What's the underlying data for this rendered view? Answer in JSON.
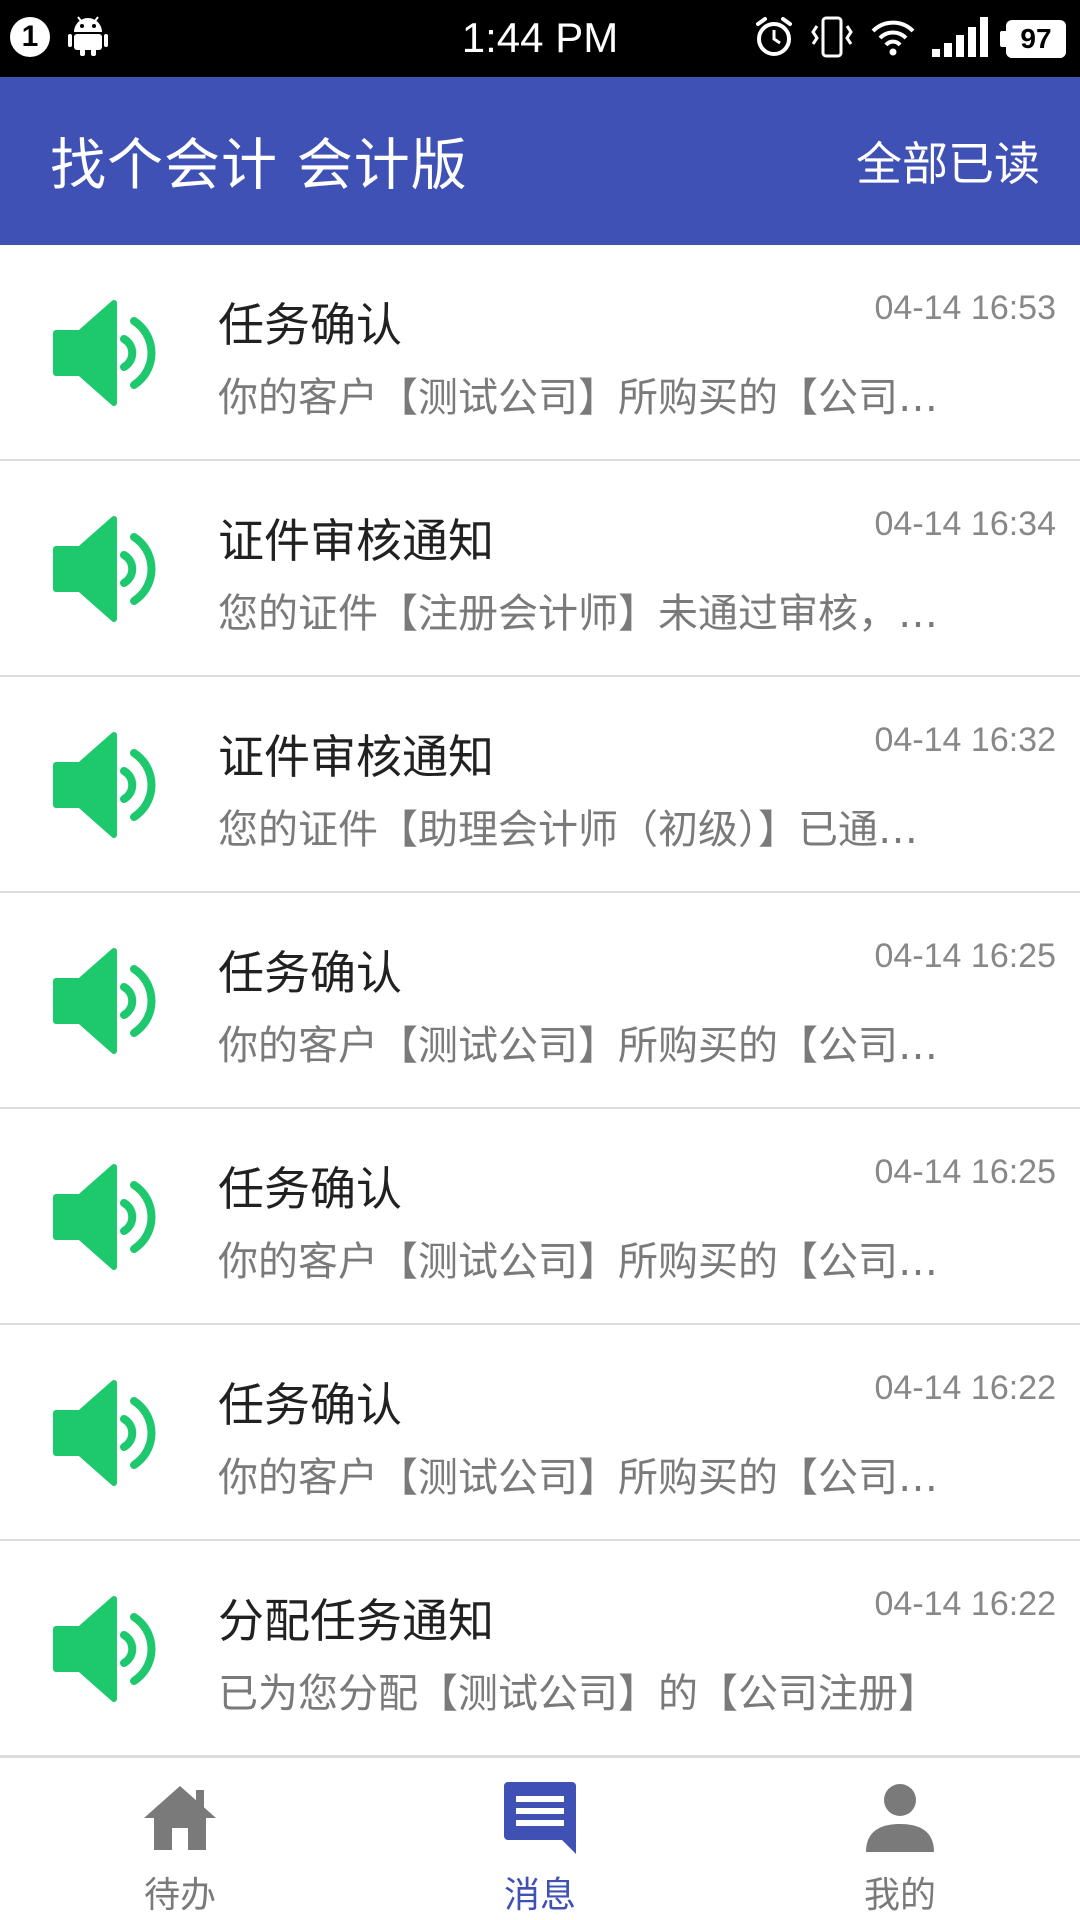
{
  "status_bar": {
    "notification_count": "1",
    "time": "1:44 PM",
    "battery": "97",
    "icons": [
      "android-icon",
      "alarm-icon",
      "vibrate-icon",
      "wifi-icon",
      "signal-icon",
      "battery-icon"
    ]
  },
  "app_bar": {
    "title": "找个会计 会计版",
    "mark_all_read": "全部已读"
  },
  "messages": [
    {
      "title": "任务确认",
      "time": "04-14 16:53",
      "summary": "你的客户【测试公司】所购买的【公司…",
      "icon": "speaker-icon"
    },
    {
      "title": "证件审核通知",
      "time": "04-14 16:34",
      "summary": "您的证件【注册会计师】未通过审核，…",
      "icon": "speaker-icon"
    },
    {
      "title": "证件审核通知",
      "time": "04-14 16:32",
      "summary": "您的证件【助理会计师（初级）】已通…",
      "icon": "speaker-icon"
    },
    {
      "title": "任务确认",
      "time": "04-14 16:25",
      "summary": "你的客户【测试公司】所购买的【公司…",
      "icon": "speaker-icon"
    },
    {
      "title": "任务确认",
      "time": "04-14 16:25",
      "summary": "你的客户【测试公司】所购买的【公司…",
      "icon": "speaker-icon"
    },
    {
      "title": "任务确认",
      "time": "04-14 16:22",
      "summary": "你的客户【测试公司】所购买的【公司…",
      "icon": "speaker-icon"
    },
    {
      "title": "分配任务通知",
      "time": "04-14 16:22",
      "summary": "已为您分配【测试公司】的【公司注册】",
      "icon": "speaker-icon"
    }
  ],
  "bottom_nav": [
    {
      "label": "待办",
      "icon": "home-icon",
      "active": false
    },
    {
      "label": "消息",
      "icon": "message-icon",
      "active": true
    },
    {
      "label": "我的",
      "icon": "person-icon",
      "active": false
    }
  ],
  "colors": {
    "primary": "#3f51b5",
    "speaker_green": "#1ec96e",
    "inactive_gray": "#7a7a7a"
  }
}
